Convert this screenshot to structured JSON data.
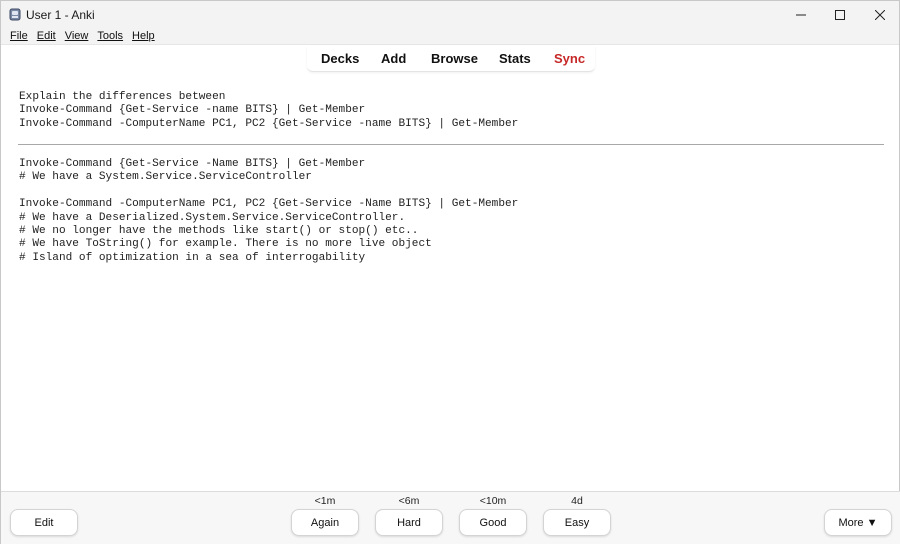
{
  "window": {
    "title": "User 1 - Anki",
    "icon": "anki-app-icon"
  },
  "menu": {
    "items": [
      {
        "label": "File"
      },
      {
        "label": "Edit"
      },
      {
        "label": "View"
      },
      {
        "label": "Tools"
      },
      {
        "label": "Help"
      }
    ]
  },
  "toolbar": {
    "decks": "Decks",
    "add": "Add",
    "browse": "Browse",
    "stats": "Stats",
    "sync": "Sync",
    "sync_color": "#c62828"
  },
  "card": {
    "question_lines": [
      "Explain the differences between",
      "Invoke-Command {Get-Service -name BITS} | Get-Member",
      "Invoke-Command -ComputerName PC1, PC2 {Get-Service -name BITS} | Get-Member"
    ],
    "answer_lines": [
      "Invoke-Command {Get-Service -Name BITS} | Get-Member",
      "# We have a System.Service.ServiceController",
      "",
      "Invoke-Command -ComputerName PC1, PC2 {Get-Service -Name BITS} | Get-Member",
      "# We have a Deserialized.System.Service.ServiceController.",
      "# We no longer have the methods like start() or stop() etc..",
      "# We have ToString() for example. There is no more live object",
      "# Island of optimization in a sea of interrogability"
    ]
  },
  "bottom": {
    "edit_label": "Edit",
    "more_label": "More ▼",
    "answers": [
      {
        "label": "Again",
        "interval": "<1m"
      },
      {
        "label": "Hard",
        "interval": "<6m"
      },
      {
        "label": "Good",
        "interval": "<10m"
      },
      {
        "label": "Easy",
        "interval": "4d"
      }
    ]
  }
}
